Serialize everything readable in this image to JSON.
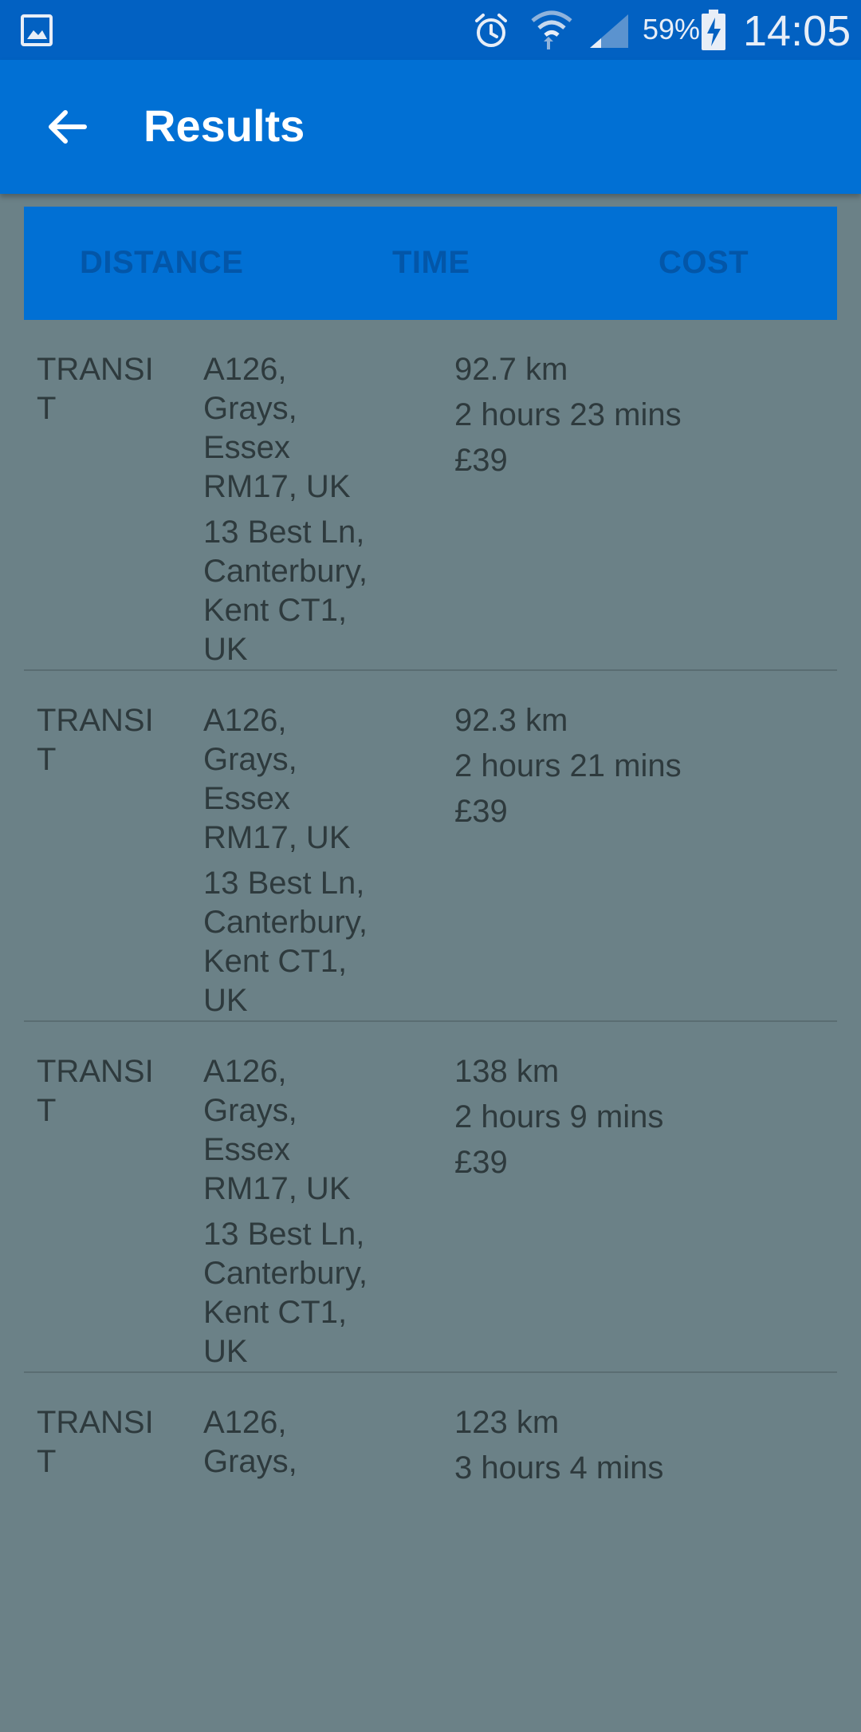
{
  "status_bar": {
    "battery": "59%",
    "time": "14:05",
    "icons": [
      "gallery-icon",
      "alarm-icon",
      "wifi-icon",
      "signal-icon",
      "battery-charging-icon"
    ]
  },
  "app_bar": {
    "title": "Results",
    "back_icon": "arrow-left-icon"
  },
  "sort_tabs": {
    "distance": "DISTANCE",
    "time": "TIME",
    "cost": "COST"
  },
  "results": [
    {
      "mode": "TRANSI\nT",
      "from": "A126,\nGrays,\nEssex\nRM17, UK",
      "to": "13 Best Ln,\nCanterbury,\nKent CT1,\nUK",
      "distance": "92.7 km",
      "duration": "2 hours 23 mins",
      "cost": "£39"
    },
    {
      "mode": "TRANSI\nT",
      "from": "A126,\nGrays,\nEssex\nRM17, UK",
      "to": "13 Best Ln,\nCanterbury,\nKent CT1,\nUK",
      "distance": "92.3 km",
      "duration": "2 hours 21 mins",
      "cost": "£39"
    },
    {
      "mode": "TRANSI\nT",
      "from": "A126,\nGrays,\nEssex\nRM17, UK",
      "to": "13 Best Ln,\nCanterbury,\nKent CT1,\nUK",
      "distance": "138 km",
      "duration": "2 hours 9 mins",
      "cost": "£39"
    },
    {
      "mode": "TRANSI\nT",
      "from": "A126,\nGrays,",
      "distance": "123 km",
      "duration": "3 hours 4 mins"
    }
  ],
  "colors": {
    "status_bar": "#0261c2",
    "app_bar": "#0170d4",
    "background": "#6b8187",
    "tab_text": "#0356a8",
    "row_text": "#2e3a3d"
  }
}
